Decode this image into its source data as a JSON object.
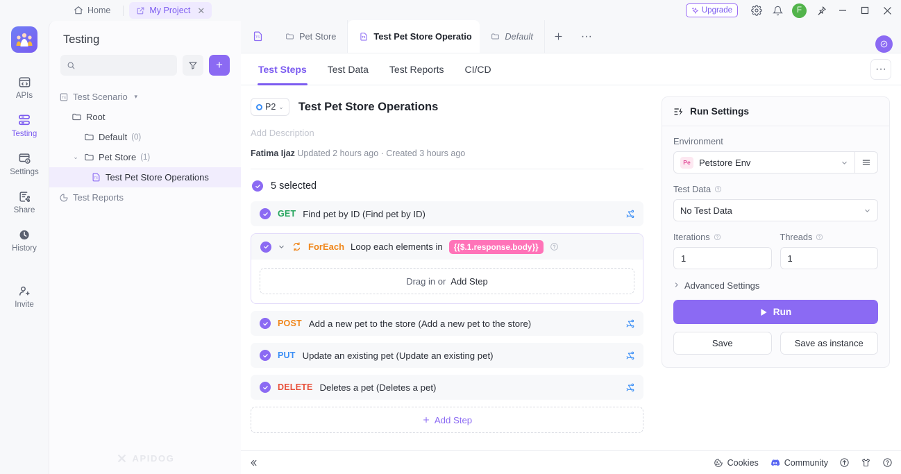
{
  "titlebar": {
    "home_label": "Home",
    "project_tab_label": "My Project",
    "close_glyph": "✕",
    "upgrade_label": "Upgrade",
    "avatar_initial": "F",
    "minimize_glyph": "─",
    "maximize_glyph": "□",
    "close_window_glyph": "✕"
  },
  "rail": {
    "items": [
      {
        "label": "APIs",
        "icon": "apis-icon",
        "active": false
      },
      {
        "label": "Testing",
        "icon": "testing-icon",
        "active": true
      },
      {
        "label": "Settings",
        "icon": "settings-icon",
        "active": false
      },
      {
        "label": "Share",
        "icon": "share-icon",
        "active": false
      },
      {
        "label": "History",
        "icon": "history-icon",
        "active": false
      },
      {
        "label": "Invite",
        "icon": "invite-icon",
        "active": false
      }
    ]
  },
  "sidebar": {
    "title": "Testing",
    "search_placeholder": "",
    "add_label": "+",
    "tree": {
      "root_label": "Test Scenario",
      "nodes": [
        {
          "label": "Root",
          "count": ""
        },
        {
          "label": "Default",
          "count": "(0)"
        },
        {
          "label": "Pet Store",
          "count": "(1)"
        },
        {
          "label": "Test Pet Store Operations",
          "count": ""
        }
      ],
      "reports_label": "Test Reports"
    },
    "watermark": "APIDOG"
  },
  "doc_tabs": {
    "tabs": [
      {
        "label": "Pet Store",
        "icon": "folder-icon",
        "active": false,
        "italic": false
      },
      {
        "label": "Test Pet Store Operatio",
        "icon": "scenario-icon",
        "active": true,
        "italic": false
      },
      {
        "label": "Default",
        "icon": "folder-icon",
        "active": false,
        "italic": true
      }
    ],
    "plus_glyph": "+",
    "more_glyph": "···"
  },
  "sub_tabs": {
    "tabs": [
      {
        "label": "Test Steps",
        "active": true
      },
      {
        "label": "Test Data",
        "active": false
      },
      {
        "label": "Test Reports",
        "active": false
      },
      {
        "label": "CI/CD",
        "active": false
      }
    ],
    "more_glyph": "···"
  },
  "scenario": {
    "priority": "P2",
    "title": "Test Pet Store Operations",
    "description_placeholder": "Add Description",
    "author": "Fatima Ijaz",
    "meta": "Updated 2 hours ago · Created 3 hours ago",
    "selected_label": "5 selected"
  },
  "steps": [
    {
      "type": "request",
      "verb": "GET",
      "verb_color": "#25a55d",
      "name": "Find pet by ID (Find pet by ID)"
    },
    {
      "type": "loop",
      "keyword": "ForEach",
      "text": "Loop each elements in",
      "variable": "{{$.1.response.body}}",
      "dropzone_prefix": "Drag in or",
      "dropzone_link": "Add Step"
    },
    {
      "type": "request",
      "verb": "POST",
      "verb_color": "#f0861a",
      "name": "Add a new pet to the store (Add a new pet to the store)"
    },
    {
      "type": "request",
      "verb": "PUT",
      "verb_color": "#3a8ef6",
      "name": "Update an existing pet (Update an existing pet)"
    },
    {
      "type": "request",
      "verb": "DELETE",
      "verb_color": "#e8503a",
      "name": "Deletes a pet (Deletes a pet)"
    }
  ],
  "add_step_label": "Add Step",
  "run_settings": {
    "header": "Run Settings",
    "environment_label": "Environment",
    "environment_badge": "Pe",
    "environment_value": "Petstore Env",
    "test_data_label": "Test Data",
    "test_data_value": "No Test Data",
    "iterations_label": "Iterations",
    "iterations_value": "1",
    "threads_label": "Threads",
    "threads_value": "1",
    "advanced_label": "Advanced Settings",
    "run_label": "Run",
    "save_label": "Save",
    "save_instance_label": "Save as instance"
  },
  "statusbar": {
    "collapse_glyph": "«",
    "cookies_label": "Cookies",
    "community_label": "Community"
  },
  "colors": {
    "accent": "#8b6af3",
    "accent_text": "#7c5cf0",
    "pill_pink": "#ff73b8",
    "get_green": "#25a55d",
    "post_orange": "#f0861a",
    "put_blue": "#3a8ef6",
    "delete_red": "#e8503a",
    "avatar_green": "#52b44b"
  }
}
